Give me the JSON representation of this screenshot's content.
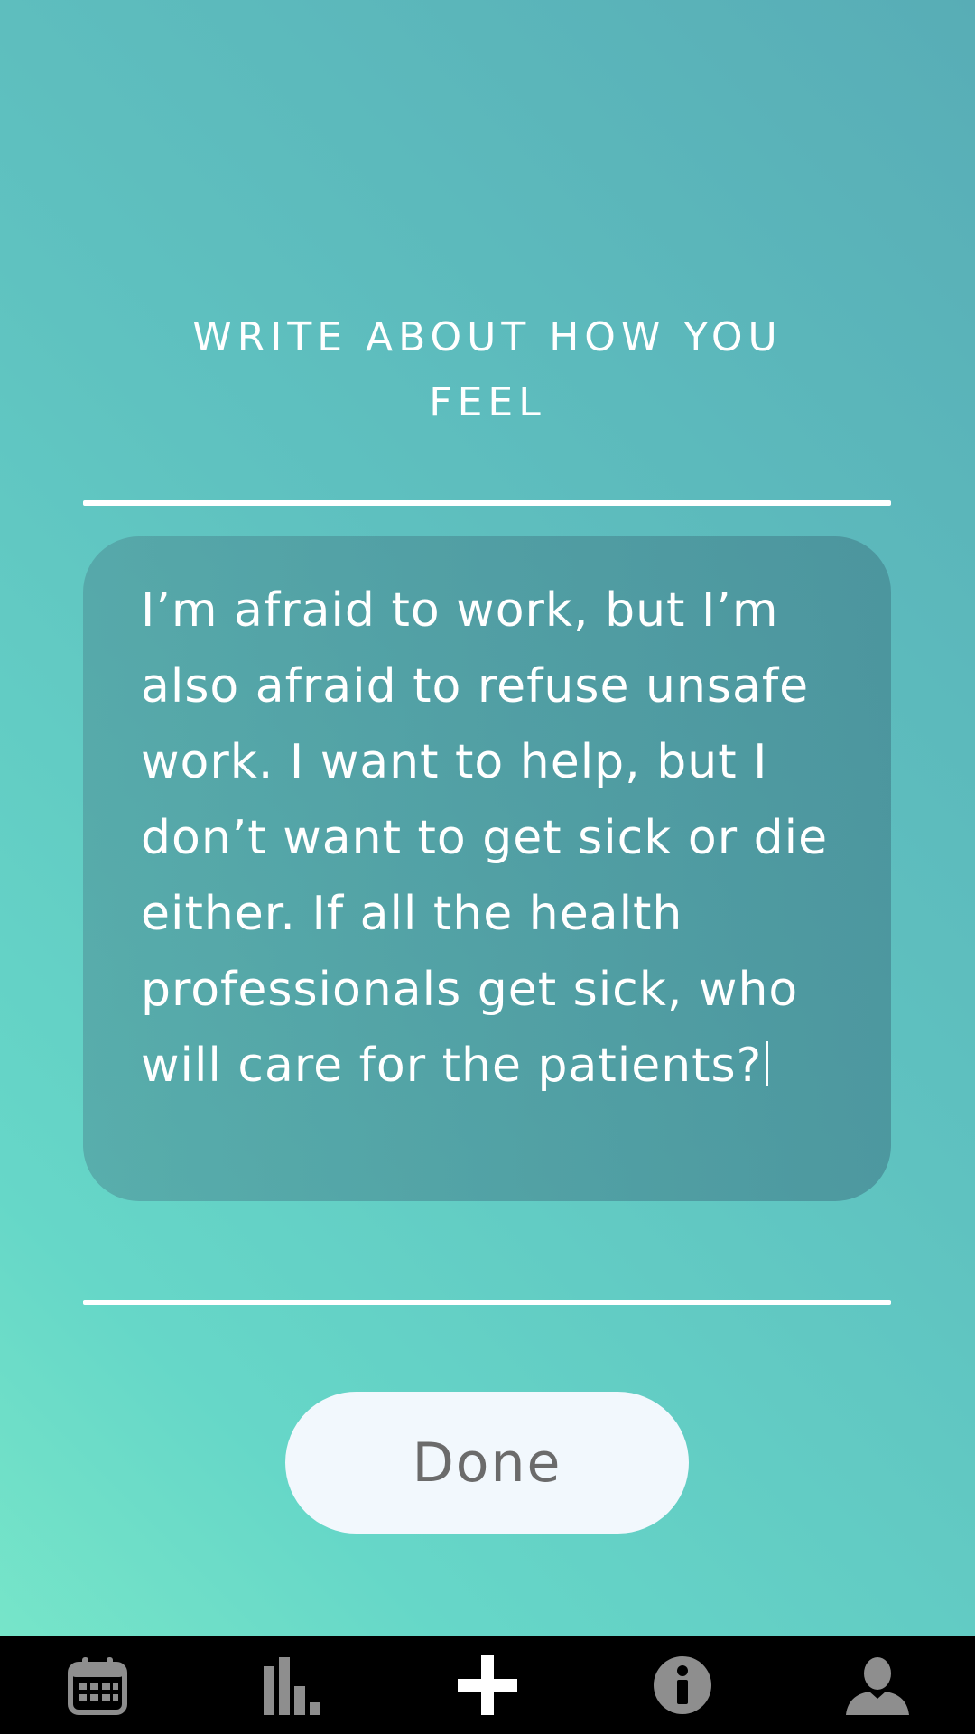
{
  "prompt": {
    "title_line1": "WRITE ABOUT HOW YOU",
    "title_line2": "FEEL"
  },
  "entry": {
    "text": "I’m afraid to work, but I’m also afraid to refuse unsafe work. I want to help, but I don’t want to get sick or die either. If all the health professionals get sick, who will care for the patients?"
  },
  "actions": {
    "done_label": "Done"
  },
  "tab_bar": {
    "tabs": [
      {
        "icon": "calendar-icon",
        "active": false
      },
      {
        "icon": "bar-chart-icon",
        "active": false
      },
      {
        "icon": "plus-icon",
        "active": true
      },
      {
        "icon": "info-icon",
        "active": false
      },
      {
        "icon": "person-icon",
        "active": false
      }
    ]
  },
  "colors": {
    "background_start": "#7ae8c9",
    "background_end": "#58adb6",
    "tab_bar": "#000000",
    "tab_icon_inactive": "#8e8e8e",
    "tab_icon_active": "#ffffff",
    "button_bg": "#f2f8fd",
    "button_text": "#6b6b6b"
  }
}
